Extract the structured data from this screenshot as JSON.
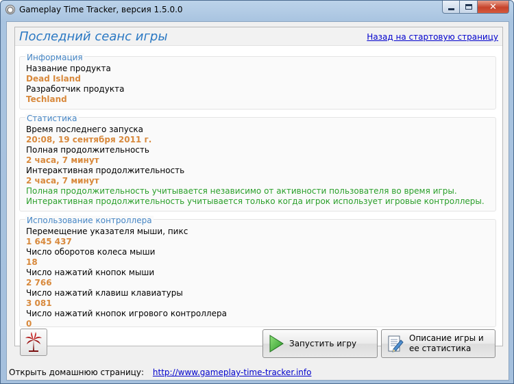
{
  "window": {
    "title": "Gameplay Time Tracker, версия 1.5.0.0",
    "close_glyph": "✕"
  },
  "header": {
    "title": "Последний сеанс игры",
    "back_link": "Назад на стартовую страницу"
  },
  "info": {
    "title": "Информация",
    "product_label": "Название продукта",
    "product_value": "Dead Island",
    "developer_label": "Разработчик продукта",
    "developer_value": "Techland"
  },
  "stats": {
    "title": "Статистика",
    "last_launch_label": "Время последнего запуска",
    "last_launch_value": "20:08, 19 сентября 2011 г.",
    "total_label": "Полная продолжительность",
    "total_value": "2 часа, 7 минут",
    "interactive_label": "Интерактивная продолжительность",
    "interactive_value": "2 часа, 7 минут",
    "note_total": "Полная продолжительность учитывается независимо от активности пользователя во время игры.",
    "note_interactive": "Интерактивная продолжительность учитывается только когда игрок использует игровые контроллеры."
  },
  "controllers": {
    "title": "Использование контроллера",
    "mouse_move_label": "Перемещение указателя мыши, пикс",
    "mouse_move_value": "1 645 437",
    "wheel_label": "Число оборотов колеса мыши",
    "wheel_value": "18",
    "mouse_clicks_label": "Число нажатий кнопок мыши",
    "mouse_clicks_value": "2 766",
    "keys_label": "Число нажатий клавиш клавиатуры",
    "keys_value": "3 081",
    "gamepad_label": "Число нажатий кнопок игрового контроллера",
    "gamepad_value": "0"
  },
  "buttons": {
    "start_label": "Запустить игру",
    "desc_line1": "Описание игры и",
    "desc_line2": "ее статистика"
  },
  "statusbar": {
    "label": "Открыть домашнюю страницу:",
    "link": "http://www.gameplay-time-tracker.info"
  },
  "colors": {
    "title_blue": "#2a78c3",
    "group_title_blue": "#4585c4",
    "value_orange": "#d8893c",
    "note_green": "#2a9f2a",
    "link_blue": "#0000cc"
  }
}
